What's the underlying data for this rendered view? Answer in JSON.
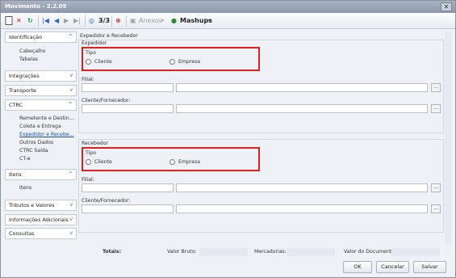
{
  "window": {
    "title": "Movimento - 2.2.09",
    "close_glyph": "✕"
  },
  "toolbar": {
    "nav_counter": "3/3",
    "anexos_label": "Anexos",
    "mashups_label": "Mashups",
    "caret": "▾"
  },
  "sidebar": {
    "identificacao": "Identificação",
    "identificacao_items": [
      "Cabeçalho",
      "Tabelas"
    ],
    "integracoes": "Integrações",
    "transporte": "Transporte",
    "ctrc": "CTRC",
    "ctrc_items": [
      "Remetente e Destin...",
      "Coleta e Entrega",
      "Expedidor e Recebe...",
      "Outros Dados",
      "CTRC Saída",
      "CT-e"
    ],
    "itens": "Itens",
    "itens_items": [
      "Itens"
    ],
    "tributos": "Tributos e Valores",
    "informacoes": "Informações Adicionais",
    "consultas": "Consultas",
    "chevron_up": "^",
    "chevron_down": "v"
  },
  "main": {
    "section_title": "Expedidor e Recebedor",
    "expedidor": {
      "title": "Expedidor",
      "tipo_label": "Tipo",
      "option_cliente": "Cliente",
      "option_empresa": "Empresa",
      "filial_label": "Filial:",
      "cliente_label": "Cliente/Fornecedor:"
    },
    "recebedor": {
      "title": "Recebedor",
      "tipo_label": "Tipo",
      "option_cliente": "Cliente",
      "option_empresa": "Empresa",
      "filial_label": "Filial:",
      "cliente_label": "Cliente/Fornecedor:"
    },
    "ellipsis": "..."
  },
  "totals": {
    "label": "Totais:",
    "valor_bruto": "Valor Bruto:",
    "mercadorias": "Mercadorias:",
    "valor_documento": "Valor do Documento:"
  },
  "buttons": {
    "ok": "OK",
    "cancelar": "Cancelar",
    "salvar": "Salvar"
  },
  "colors": {
    "highlight": "#e02020",
    "link": "#1f4fa8"
  }
}
